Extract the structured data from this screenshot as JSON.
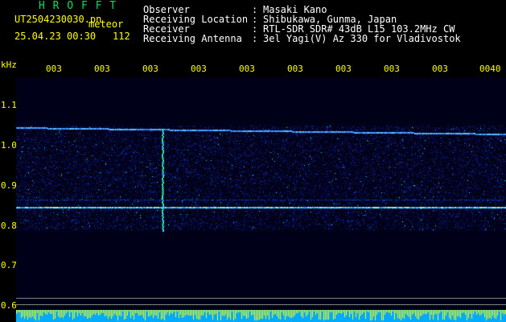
{
  "header": {
    "logo": "H R O F F T",
    "filename": "UT2504230030.pn",
    "meteor_label": "meteor",
    "date_time": "25.04.23 00:30",
    "count": "112"
  },
  "meta": {
    "rows": [
      {
        "label": "Observer",
        "sep": ":",
        "value": "Masaki Kano"
      },
      {
        "label": "Receiving Location",
        "sep": ":",
        "value": "Shibukawa, Gunma, Japan"
      },
      {
        "label": "Receiver",
        "sep": ":",
        "value": "RTL-SDR SDR# 43dB L15 103.2MHz CW"
      },
      {
        "label": "Receiving Antenna",
        "sep": ":",
        "value": "3el Yagi(V) Az 330 for Vladivostok"
      }
    ]
  },
  "axis": {
    "unit": "kHz",
    "y_ticks": [
      "1.1",
      "1.0",
      "0.9",
      "0.8",
      "0.7",
      "0.6"
    ],
    "x_ticks": [
      "003",
      "003",
      "003",
      "003",
      "003",
      "003",
      "003",
      "003",
      "003",
      "0040"
    ]
  },
  "colors": {
    "text_primary": "#ffff00",
    "text_meta": "#ffffff",
    "logo": "#00e060",
    "background": "#000000",
    "spectro_bg": "#000018",
    "strip": "#00aaff"
  }
}
